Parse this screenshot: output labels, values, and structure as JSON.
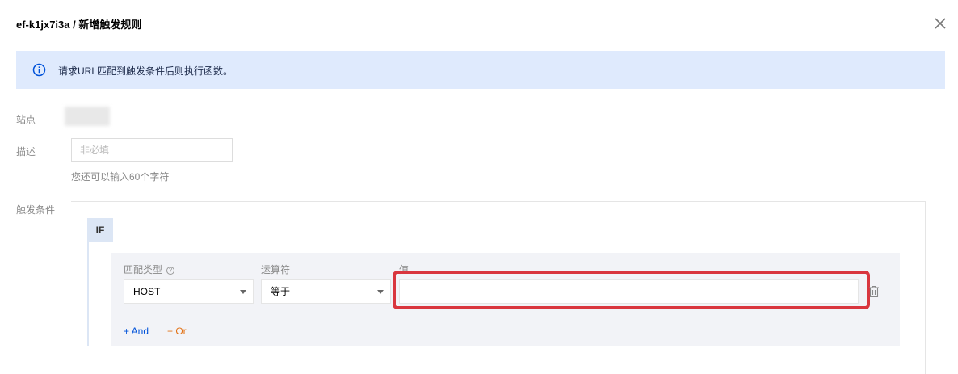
{
  "header": {
    "title": "ef-k1jx7i3a / 新增触发规则"
  },
  "banner": {
    "text": "请求URL匹配到触发条件后则执行函数。",
    "icon": "info-icon"
  },
  "form": {
    "site_label": "站点",
    "desc_label": "描述",
    "desc_value": "",
    "desc_placeholder": "非必填",
    "desc_hint": "您还可以输入60个字符",
    "cond_label": "触发条件"
  },
  "condition": {
    "if_label": "IF",
    "match_type_label": "匹配类型",
    "operator_label": "运算符",
    "value_label": "值",
    "match_type_value": "HOST",
    "operator_value": "等于",
    "value_value": "",
    "add_and_label": "+ And",
    "add_or_label": "+ Or"
  },
  "colors": {
    "accent": "#0052d9",
    "or": "#e37318",
    "banner_bg": "#dfeafd",
    "highlight": "#d9363e"
  }
}
